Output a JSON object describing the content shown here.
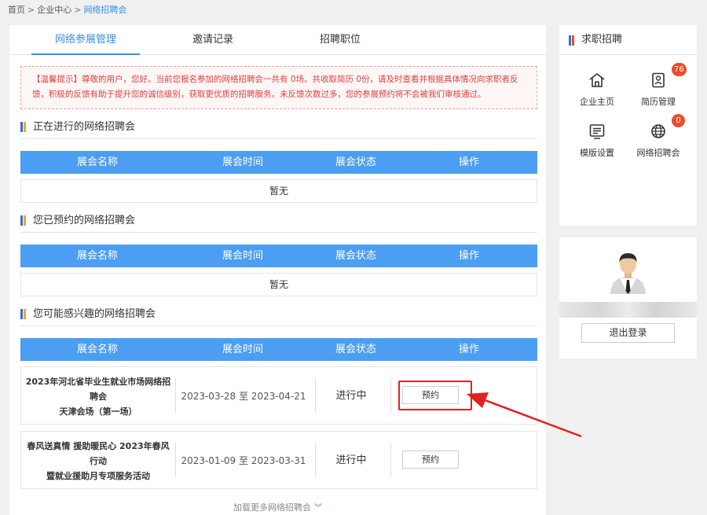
{
  "breadcrumb": [
    "首页",
    "企业中心",
    "网络招聘会"
  ],
  "tabs": [
    {
      "label": "网络参展管理",
      "active": true
    },
    {
      "label": "邀请记录",
      "active": false
    },
    {
      "label": "招聘职位",
      "active": false
    }
  ],
  "notice": {
    "line1": "【温馨提示】尊敬的用户，您好。当前您报名参加的网络招聘会一共有 0场。共收取简历 0份，请及时查看并根据具体情况向求职者反",
    "line2": "馈，积极的反馈有助于提升您的诚信级别，获取更优质的招聘服务。未反馈次数过多，您的参展预约将不会被我们审核通过。"
  },
  "table_headers": [
    "展会名称",
    "展会时间",
    "展会状态",
    "操作"
  ],
  "sections": {
    "ongoing": {
      "title": "正在进行的网络招聘会",
      "empty": "暂无"
    },
    "booked": {
      "title": "您已预约的网络招聘会",
      "empty": "暂无"
    },
    "interested": {
      "title": "您可能感兴趣的网络招聘会"
    }
  },
  "fairs": [
    {
      "name_line1": "2023年河北省毕业生就业市场网络招聘会",
      "name_line2": "天津会场（第一场）",
      "time": "2023-03-28 至 2023-04-21",
      "status": "进行中",
      "action": "预约"
    },
    {
      "name_line1": "春风送真情 援助暖民心 2023年春风行动",
      "name_line2": "暨就业援助月专项服务活动",
      "time": "2023-01-09 至 2023-03-31",
      "status": "进行中",
      "action": "预约"
    }
  ],
  "load_more": "加载更多网络招聘会",
  "sidebar": {
    "title": "求职招聘",
    "items": [
      {
        "label": "企业主页",
        "icon": "home-icon"
      },
      {
        "label": "简历管理",
        "icon": "resume-icon",
        "badge": "76"
      },
      {
        "label": "模版设置",
        "icon": "template-icon"
      },
      {
        "label": "网络招聘会",
        "icon": "globe-icon",
        "badge": "0"
      }
    ]
  },
  "account": {
    "logout": "退出登录"
  },
  "colors": {
    "accent": "#4b9ef2",
    "notice_red": "#e04040",
    "badge": "#f04a2a",
    "highlight": "#e32020"
  }
}
